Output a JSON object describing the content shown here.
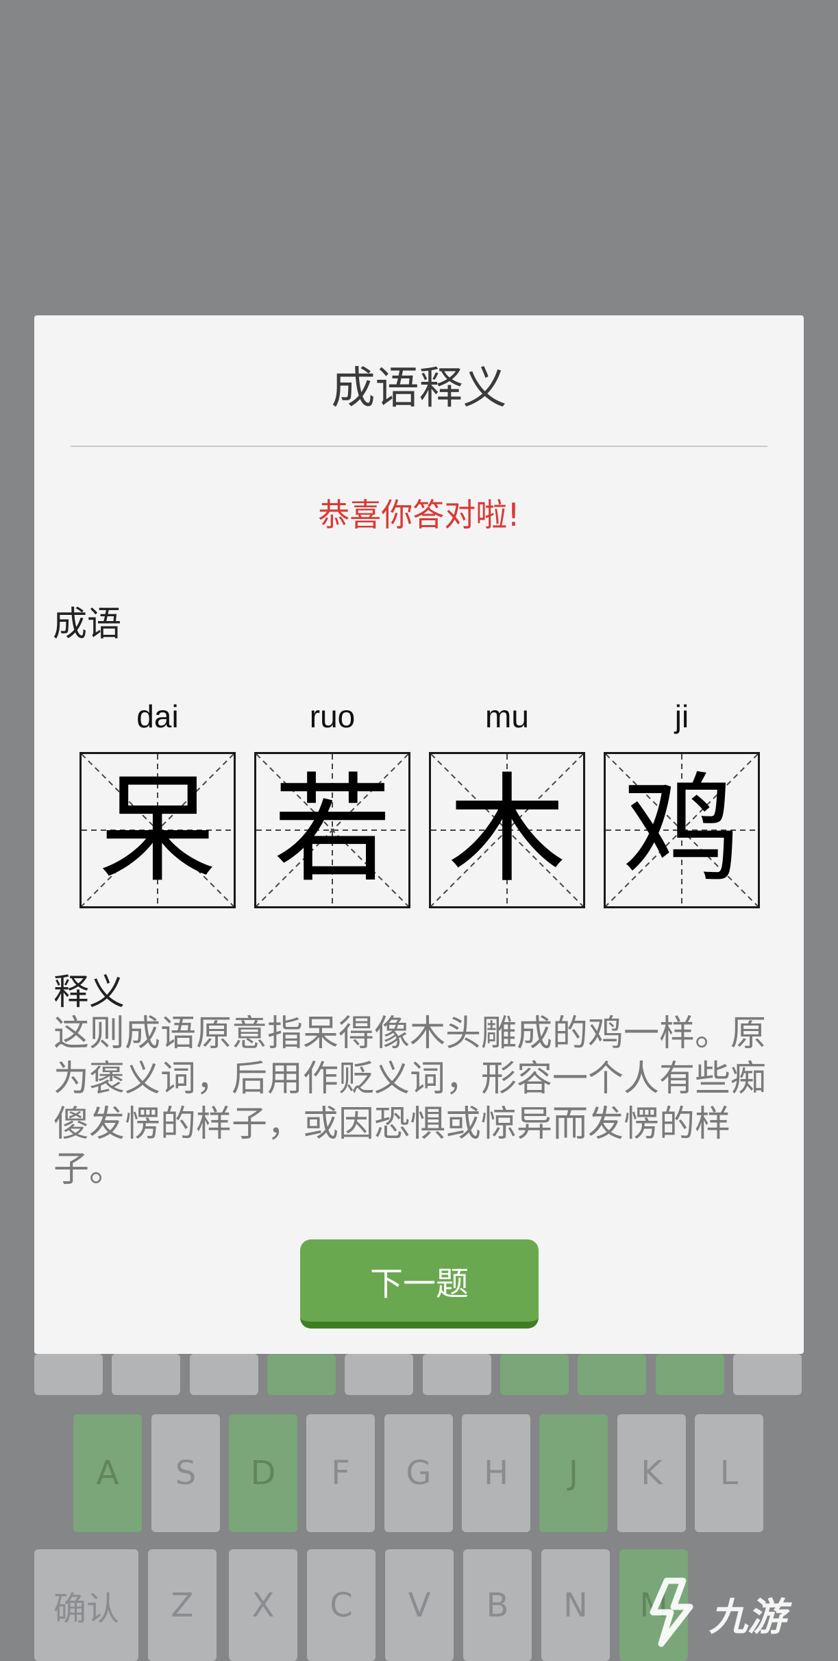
{
  "modal": {
    "title": "成语释义",
    "success_message": "恭喜你答对啦!",
    "idiom_label": "成语",
    "characters": [
      {
        "pinyin": "dai",
        "char": "呆"
      },
      {
        "pinyin": "ruo",
        "char": "若"
      },
      {
        "pinyin": "mu",
        "char": "木"
      },
      {
        "pinyin": "ji",
        "char": "鸡"
      }
    ],
    "definition_label": "释义",
    "definition": "这则成语原意指呆得像木头雕成的鸡一样。原为褒义词，后用作贬义词，形容一个人有些痴傻发愣的样子，或因恐惧或惊异而发愣的样子。",
    "next_button": "下一题"
  },
  "keyboard": {
    "row1": [
      "A",
      "S",
      "D",
      "F",
      "G",
      "H",
      "J",
      "K",
      "L"
    ],
    "row2": [
      "确认",
      "Z",
      "X",
      "C",
      "V",
      "B",
      "N",
      "M"
    ],
    "highlight_color": "#7aa679"
  },
  "watermark": {
    "text": "九游"
  }
}
